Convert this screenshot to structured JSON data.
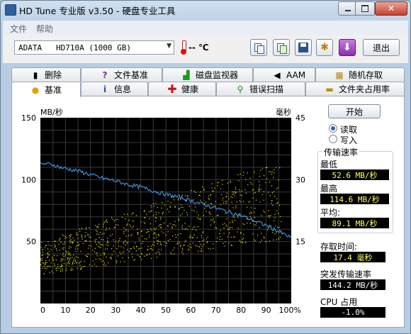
{
  "window": {
    "title": "HD Tune 专业版 v3.50 - 硬盘专业工具"
  },
  "menu": {
    "file": "文件",
    "help": "帮助"
  },
  "toolbar": {
    "drive": "ADATA   HD710A (1000 GB)",
    "temperature": "-- ℃",
    "exit_label": "退出",
    "icons": [
      "copy-text-icon",
      "copy-screen-icon",
      "save-icon",
      "options-icon",
      "download-icon"
    ]
  },
  "tabs_top": [
    "删除",
    "文件基准",
    "磁盘监视器",
    "AAM",
    "随机存取"
  ],
  "tabs_bottom": [
    "基准",
    "信息",
    "健康",
    "错误扫描",
    "文件夹占用率"
  ],
  "active_tab": "基准",
  "side": {
    "start_label": "开始",
    "radio_read": "读取",
    "radio_write": "写入",
    "selected": "读取",
    "transfer_rate_title": "传输速率",
    "min_label": "最低",
    "min_value": "52.6 MB/秒",
    "max_label": "最高",
    "max_value": "114.6 MB/秒",
    "avg_label": "平均:",
    "avg_value": "89.1 MB/秒",
    "access_time_label": "存取时间:",
    "access_time_value": "17.4 毫秒",
    "burst_label": "突发传输速率",
    "burst_value": "144.2 MB/秒",
    "cpu_label": "CPU 占用",
    "cpu_value": "-1.0%"
  },
  "chart_data": {
    "type": "line",
    "ylabel_left": "MB/秒",
    "ylabel_right": "毫秒",
    "x_ticks": [
      "0",
      "10",
      "20",
      "30",
      "40",
      "50",
      "60",
      "70",
      "80",
      "90",
      "100%"
    ],
    "y_left_ticks": [
      "150",
      "100",
      "50"
    ],
    "y_right_ticks": [
      "45",
      "30",
      "15"
    ],
    "xlim": [
      0,
      100
    ],
    "ylim_left": [
      0,
      150
    ],
    "ylim_right": [
      0,
      45
    ],
    "grid": true,
    "series": [
      {
        "name": "",
        "color": "#3a8fd8",
        "x": [
          0,
          2,
          5,
          8,
          10,
          15,
          20,
          25,
          30,
          35,
          40,
          45,
          50,
          55,
          60,
          65,
          70,
          75,
          80,
          85,
          90,
          95,
          100
        ],
        "y": [
          112,
          113,
          112,
          110,
          109,
          107,
          104,
          101,
          99,
          96,
          94,
          91,
          88,
          86,
          83,
          80,
          77,
          74,
          71,
          67,
          63,
          58,
          53
        ]
      }
    ],
    "access_time_scatter": {
      "color": "#e8e800",
      "x_range": [
        0,
        100
      ],
      "y_range_ms": [
        7,
        33
      ],
      "trend_ms": [
        [
          0,
          11
        ],
        [
          20,
          14
        ],
        [
          40,
          17
        ],
        [
          60,
          20
        ],
        [
          80,
          23
        ],
        [
          100,
          26
        ]
      ]
    }
  },
  "colors": {
    "chart_bg": "#000000",
    "grid": "#3a3a3a",
    "transfer_line": "#3a8fd8",
    "access_points": "#e8e800"
  }
}
